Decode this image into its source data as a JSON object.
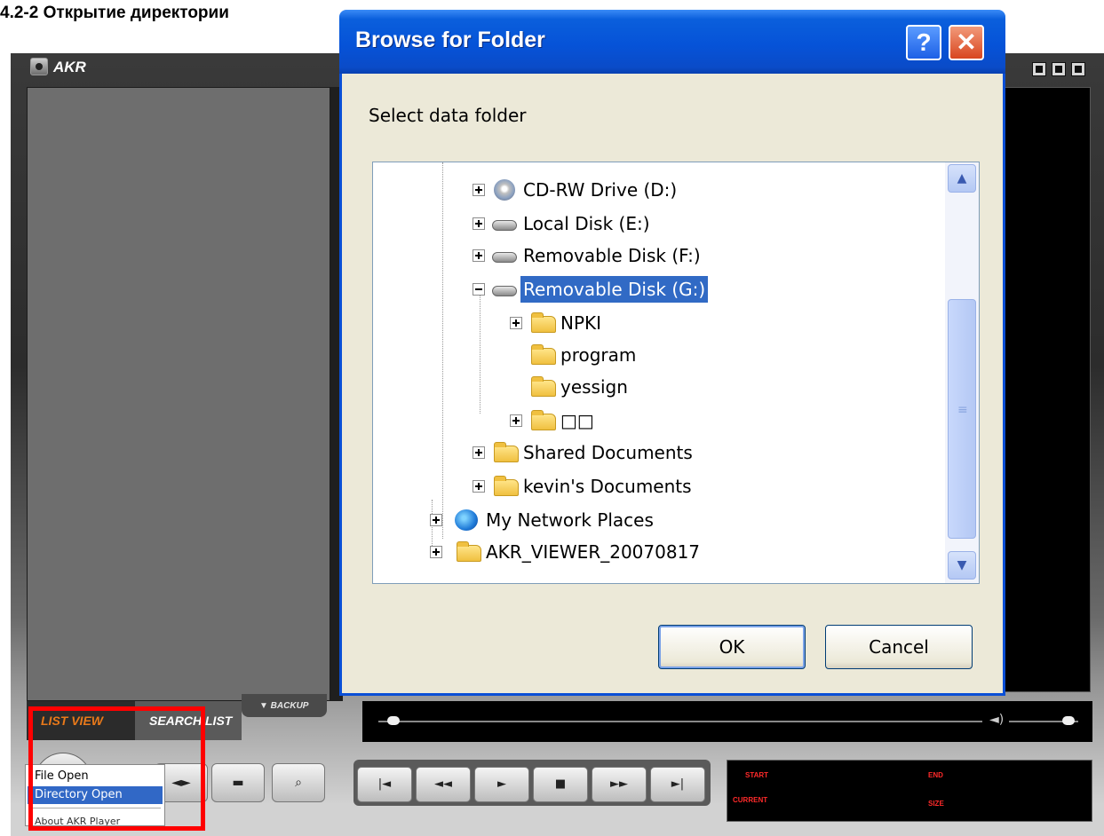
{
  "caption": "4.2-2 Открытие директории",
  "app": {
    "title": "AKR",
    "tabs": [
      "LIST VIEW",
      "SEARCH LIST"
    ],
    "backup_label": "▼ BACKUP",
    "control_icons": [
      "left-right-icon",
      "window-icon",
      "search-icon"
    ],
    "playback_icons": [
      "skip-start-icon",
      "rewind-icon",
      "play-icon",
      "stop-icon",
      "fast-forward-icon",
      "skip-end-icon"
    ],
    "info_labels": {
      "start": "START",
      "end": "END",
      "current": "CURRENT",
      "size": "SIZE"
    },
    "context_menu": {
      "items": [
        "File Open",
        "Directory Open"
      ],
      "selected": "Directory Open",
      "partial_item": "About AKR Player"
    }
  },
  "dialog": {
    "title": "Browse for Folder",
    "prompt": "Select data folder",
    "tree": [
      {
        "label": "CD-RW Drive (D:)",
        "icon": "cd-drive-icon",
        "expander": "plus"
      },
      {
        "label": "Local Disk (E:)",
        "icon": "hard-drive-icon",
        "expander": "plus"
      },
      {
        "label": "Removable Disk (F:)",
        "icon": "removable-drive-icon",
        "expander": "plus"
      },
      {
        "label": "Removable Disk (G:)",
        "icon": "removable-drive-icon",
        "expander": "minus",
        "selected": true
      },
      {
        "label": "NPKI",
        "icon": "folder-icon",
        "expander": "plus"
      },
      {
        "label": "program",
        "icon": "folder-icon",
        "expander": "none"
      },
      {
        "label": "yessign",
        "icon": "folder-icon",
        "expander": "none"
      },
      {
        "label": "□□",
        "icon": "folder-icon",
        "expander": "plus"
      },
      {
        "label": "Shared Documents",
        "icon": "folder-icon",
        "expander": "plus"
      },
      {
        "label": "kevin's Documents",
        "icon": "folder-icon",
        "expander": "plus"
      },
      {
        "label": "My Network Places",
        "icon": "network-icon",
        "expander": "plus"
      },
      {
        "label": "AKR_VIEWER_20070817",
        "icon": "folder-icon",
        "expander": "plus"
      }
    ],
    "ok_label": "OK",
    "cancel_label": "Cancel",
    "help_glyph": "?",
    "close_glyph": "✕"
  },
  "colors": {
    "title_bar": "#0653d8",
    "selection": "#316ac5",
    "highlight_box": "#ff0000",
    "list_tab_text": "#e8791a",
    "info_text": "#ff2a2a"
  }
}
